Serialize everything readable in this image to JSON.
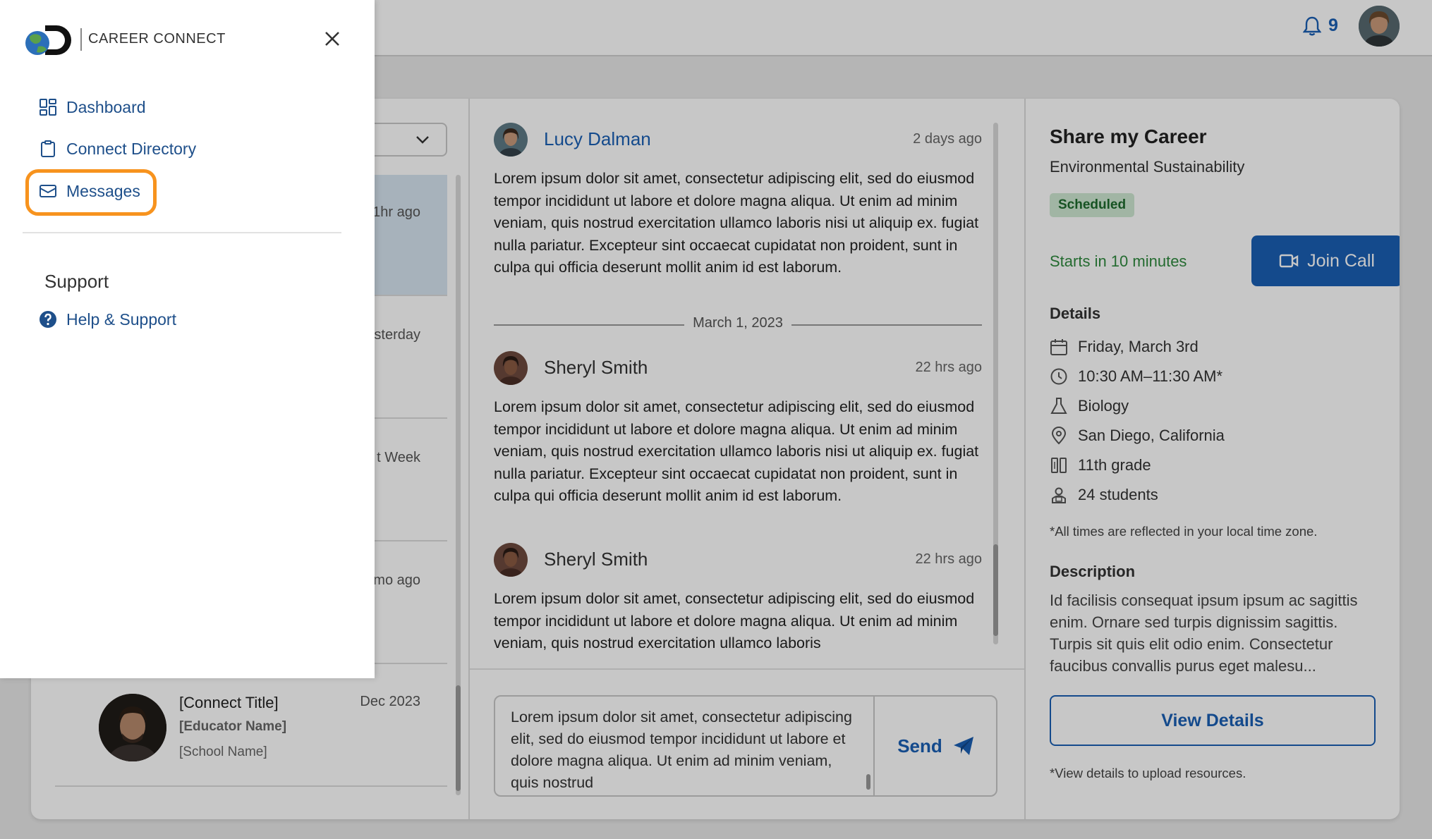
{
  "topbar": {
    "notification_count": "9"
  },
  "drawer": {
    "brand": "CAREER CONNECT",
    "nav": {
      "dashboard": "Dashboard",
      "connect_directory": "Connect Directory",
      "messages": "Messages"
    },
    "support_heading": "Support",
    "help_support": "Help & Support"
  },
  "conversations": [
    {
      "time": "1hr ago"
    },
    {
      "time": "sterday"
    },
    {
      "time": "t Week"
    },
    {
      "time": "mo ago"
    },
    {
      "title": "[Connect Title]",
      "educator": "[Educator Name]",
      "school": "[School Name]",
      "time": "Dec 2023"
    }
  ],
  "chat": {
    "messages": [
      {
        "name": "Lucy Dalman",
        "time": "2 days ago",
        "body": "Lorem ipsum dolor sit amet, consectetur adipiscing elit, sed do eiusmod tempor incididunt ut labore et dolore magna aliqua. Ut enim ad minim veniam, quis nostrud exercitation ullamco laboris nisi ut aliquip ex. fugiat nulla pariatur. Excepteur sint occaecat cupidatat non proident, sunt in culpa qui officia deserunt mollit anim id est laborum."
      },
      {
        "name": "Sheryl Smith",
        "time": "22 hrs ago",
        "body": "Lorem ipsum dolor sit amet, consectetur adipiscing elit, sed do eiusmod tempor incididunt ut labore et dolore magna aliqua. Ut enim ad minim veniam, quis nostrud exercitation ullamco laboris nisi ut aliquip ex. fugiat nulla pariatur. Excepteur sint occaecat cupidatat non proident, sunt in culpa qui officia deserunt mollit anim id est laborum."
      },
      {
        "name": "Sheryl Smith",
        "time": "22 hrs ago",
        "body": "Lorem ipsum dolor sit amet, consectetur adipiscing elit, sed do eiusmod tempor incididunt ut labore et dolore magna aliqua. Ut enim ad minim veniam, quis nostrud exercitation ullamco laboris"
      }
    ],
    "date_separator": "March 1, 2023",
    "compose_text": "Lorem ipsum dolor sit amet, consectetur adipiscing elit, sed do eiusmod tempor incididunt ut labore et dolore magna aliqua. Ut enim ad minim veniam, quis nostrud",
    "send_label": "Send"
  },
  "details": {
    "title": "Share my Career",
    "subtitle": "Environmental Sustainability",
    "status": "Scheduled",
    "starts": "Starts in 10 minutes",
    "join_label": "Join Call",
    "details_heading": "Details",
    "date": "Friday, March 3rd",
    "time": "10:30 AM–11:30 AM*",
    "subject": "Biology",
    "location": "San Diego, California",
    "grade": "11th grade",
    "students": "24 students",
    "tz_note": "*All times are reflected in your local time zone.",
    "description_heading": "Description",
    "description": "Id facilisis consequat ipsum ipsum ac sagittis enim. Ornare sed turpis dignissim sagittis. Turpis sit quis elit odio enim. Consectetur faucibus convallis purus eget malesu...",
    "view_label": "View Details",
    "upload_note": "*View details to upload resources."
  },
  "colors": {
    "brand_blue": "#1a5fb4",
    "highlight_orange": "#f7931e",
    "status_green": "#2f8a3e"
  }
}
